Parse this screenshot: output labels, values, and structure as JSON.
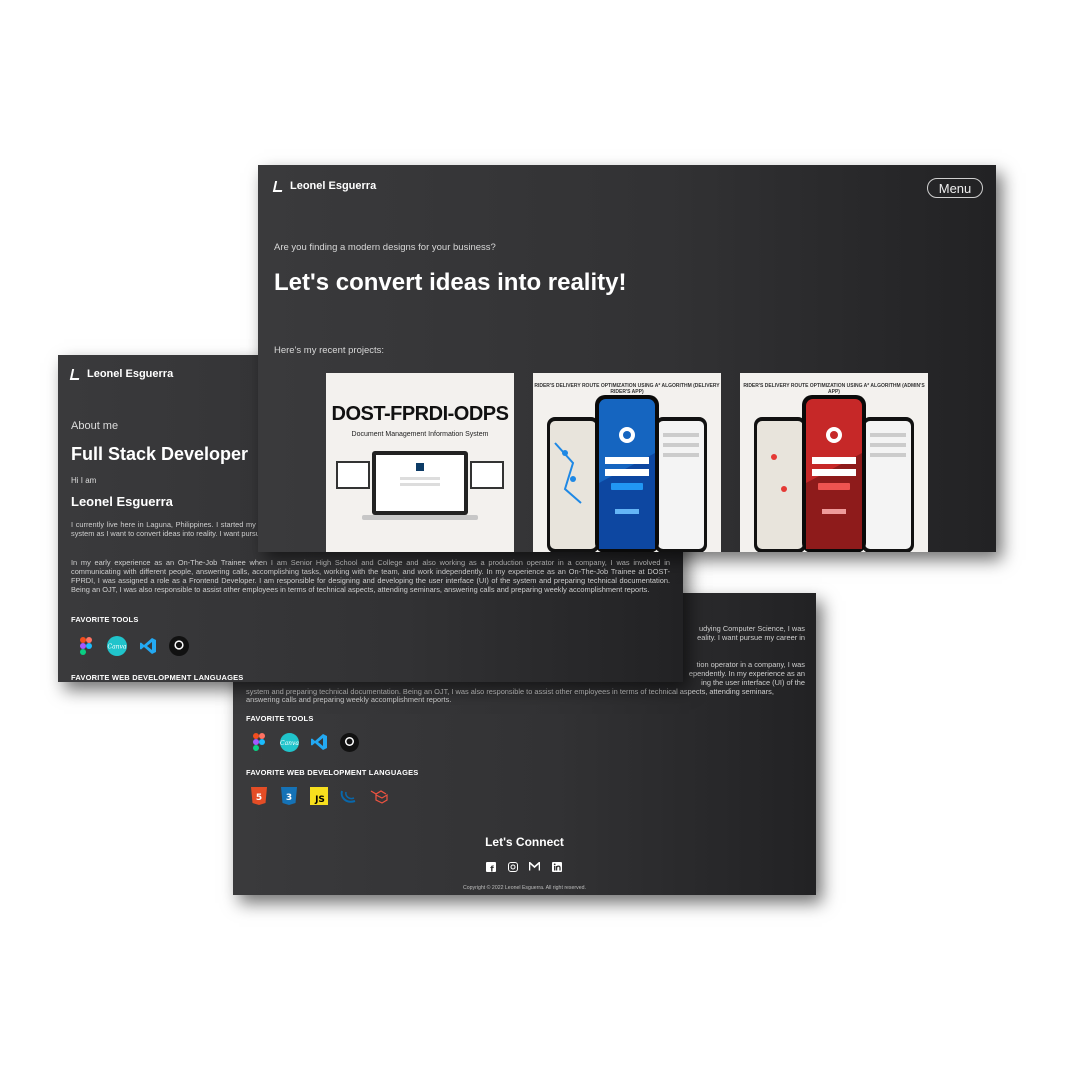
{
  "brand": {
    "name": "Leonel Esguerra"
  },
  "hero": {
    "menu_label": "Menu",
    "question": "Are you finding a modern designs for your business?",
    "headline": "Let's convert ideas into reality!",
    "projects_label": "Here's my recent projects:"
  },
  "projects": [
    {
      "title": "DOST-FPRDI-ODPS",
      "subtitle": "Document Management Information System"
    },
    {
      "title": "RIDER'S DELIVERY ROUTE OPTIMIZATION USING A* ALGORITHM (DELIVERY RIDER'S APP)",
      "accent": "#1565c0"
    },
    {
      "title": "RIDER'S DELIVERY ROUTE OPTIMIZATION USING A* ALGORITHM (ADMIN'S APP)",
      "accent": "#c62828"
    }
  ],
  "about": {
    "section_label": "About me",
    "role": "Full Stack Developer",
    "greeting": "Hi I am",
    "name": "Leonel Esguerra",
    "para1": "I currently live here in Laguna, Philippines. I started my career in IT when I was studying Computer Science, I was interested in the field of designing and developing websites and system as I want to convert ideas into reality. I want pursue my career in designs and development of websites and system in the future.",
    "para2": "In my early experience as an On-The-Job Trainee when I am Senior High School and College and also working as a production operator in a company, I was involved in communicating with different people, answering calls, accomplishing tasks, working with the team, and work independently. In my experience as an On-The-Job Trainee at DOST-FPRDI, I was assigned a role as a Frontend Developer. I am responsible for designing and developing the user interface (UI) of the system and preparing technical documentation. Being an OJT, I was also responsible to assist other employees in terms of technical aspects, attending seminars, answering calls and preparing weekly accomplishment reports.",
    "tools_label": "FAVORITE TOOLS",
    "languages_label": "FAVORITE WEB DEVELOPMENT LANGUAGES",
    "tools": [
      "figma-icon",
      "canva-icon",
      "vscode-icon",
      "github-icon"
    ],
    "languages": [
      "html5-icon",
      "css3-icon",
      "javascript-icon",
      "jquery-icon",
      "laravel-icon"
    ]
  },
  "bottom": {
    "frag1": "udying Computer Science, I was",
    "frag2": "eality. I want pursue my career in",
    "frag3": "tion operator in a company, I was",
    "frag4": "ependently. In my experience as an",
    "frag5": "ing the user interface (UI) of the",
    "frag6": "system and preparing technical documentation. Being an OJT, I was also responsible to assist other employees in terms of technical aspects, attending seminars,",
    "frag7": "answering calls and preparing weekly accomplishment reports.",
    "connect_label": "Let's Connect",
    "social": [
      "facebook-icon",
      "instagram-icon",
      "gmail-icon",
      "linkedin-icon"
    ],
    "copyright": "Copyright © 2022 Leonel Esguerra. All right reserved."
  },
  "colors": {
    "panel": "#333335",
    "text": "#e6e6e6",
    "white": "#ffffff"
  }
}
